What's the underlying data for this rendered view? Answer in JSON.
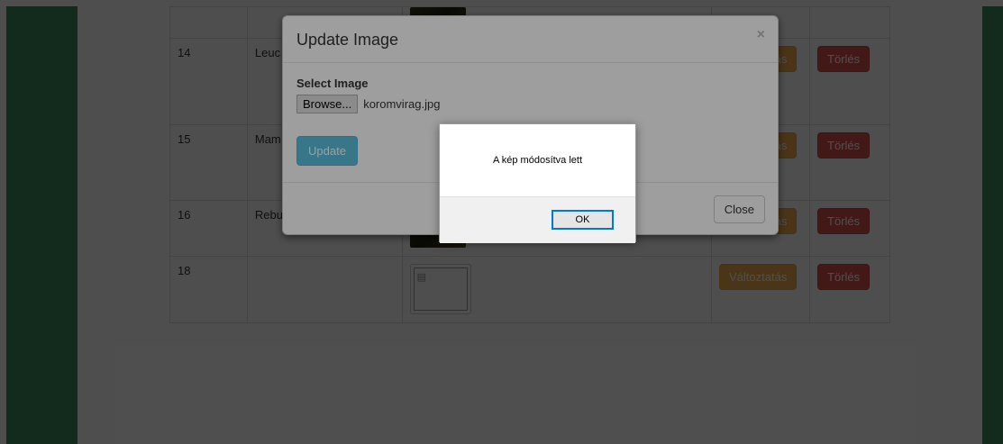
{
  "table": {
    "rows": [
      {
        "id": "",
        "name": "",
        "image": "dark",
        "edit": "",
        "delete": ""
      },
      {
        "id": "14",
        "name": "Leuc",
        "image": "none",
        "edit": "Változtatás",
        "delete": "Törlés"
      },
      {
        "id": "15",
        "name": "Mam",
        "image": "none",
        "edit": "Változtatás",
        "delete": "Törlés"
      },
      {
        "id": "16",
        "name": "Rebu",
        "image": "dark",
        "edit": "Változtatás",
        "delete": "Törlés"
      },
      {
        "id": "18",
        "name": "",
        "image": "broken",
        "edit": "Változtatás",
        "delete": "Törlés"
      }
    ]
  },
  "modal": {
    "title": "Update Image",
    "close_glyph": "×",
    "field_label": "Select Image",
    "browse_label": "Browse...",
    "file_name": "koromvirag.jpg",
    "update_label": "Update",
    "close_label": "Close"
  },
  "alert": {
    "message": "A kép módosítva lett",
    "ok_label": "OK"
  },
  "colors": {
    "accent_green": "#3c8d5f",
    "warning": "#f0ad4e",
    "danger": "#d9534f",
    "info": "#5bc0de",
    "focus_blue": "#0078d7"
  }
}
